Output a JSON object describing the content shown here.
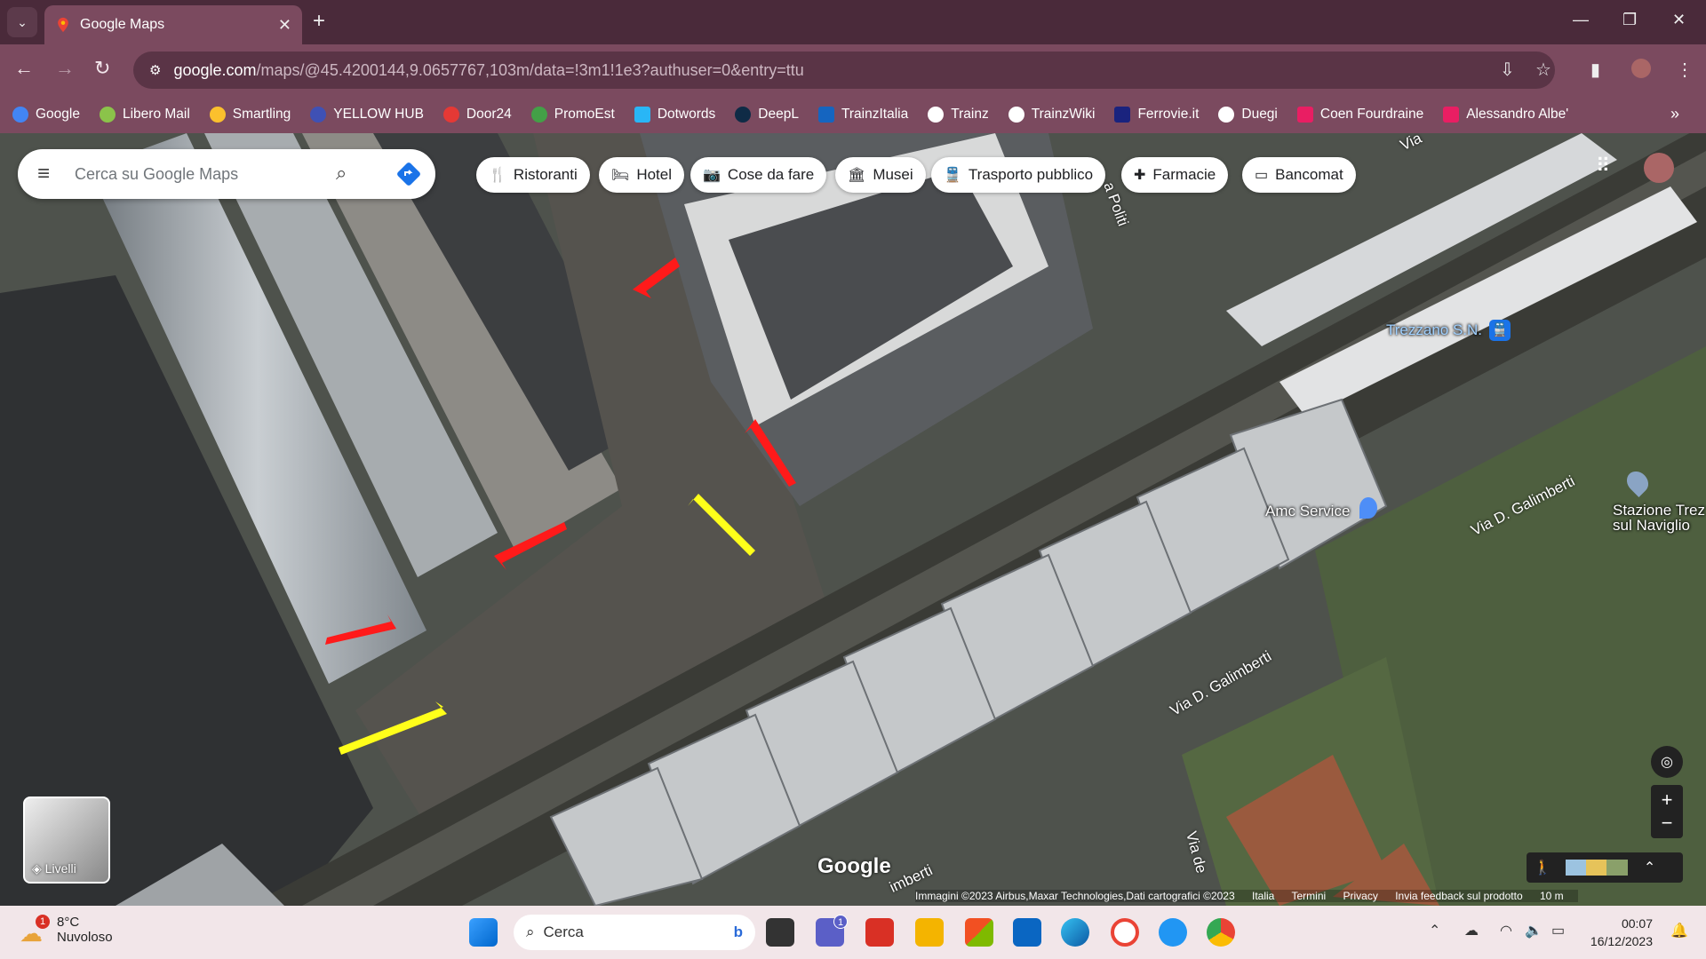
{
  "browser": {
    "tab_title": "Google Maps",
    "tab_close": "✕",
    "new_tab": "+",
    "url_host": "google.com",
    "url_path": "/maps/@45.4200144,9.0657767,103m/data=!3m1!1e3?authuser=0&entry=ttu"
  },
  "bookmarks": [
    {
      "label": "Google",
      "color": "#4285f4"
    },
    {
      "label": "Libero Mail",
      "color": "#8bc34a"
    },
    {
      "label": "Smartling",
      "color": "#fbc02d"
    },
    {
      "label": "YELLOW HUB",
      "color": "#3f51b5"
    },
    {
      "label": "Door24",
      "color": "#e53935"
    },
    {
      "label": "PromoEst",
      "color": "#43a047"
    },
    {
      "label": "Dotwords",
      "color": "#29b6f6"
    },
    {
      "label": "DeepL",
      "color": "#0f2b46"
    },
    {
      "label": "TrainzItalia",
      "color": "#1565c0"
    },
    {
      "label": "Trainz",
      "color": "#ffffff"
    },
    {
      "label": "TrainzWiki",
      "color": "#ffffff"
    },
    {
      "label": "Ferrovie.it",
      "color": "#1a237e"
    },
    {
      "label": "Duegi",
      "color": "#ffffff"
    },
    {
      "label": "Coen Fourdraine",
      "color": "#e91e63"
    },
    {
      "label": "Alessandro Albe'",
      "color": "#e91e63"
    }
  ],
  "maps": {
    "search_placeholder": "Cerca su Google Maps",
    "chips": [
      {
        "label": "Ristoranti",
        "icon": "fork-knife-icon"
      },
      {
        "label": "Hotel",
        "icon": "bed-icon"
      },
      {
        "label": "Cose da fare",
        "icon": "camera-icon"
      },
      {
        "label": "Musei",
        "icon": "museum-icon"
      },
      {
        "label": "Trasporto pubblico",
        "icon": "train-icon"
      },
      {
        "label": "Farmacie",
        "icon": "pharmacy-icon"
      },
      {
        "label": "Bancomat",
        "icon": "atm-icon"
      }
    ],
    "labels": {
      "station": "Trezzano S.N.",
      "amc": "Amc Service",
      "stazione_1": "Stazione Trez",
      "stazione_2": "sul Naviglio",
      "road_galimberti_1": "Via D. Galimberti",
      "road_galimberti_2": "Via D. Galimberti",
      "road_politi": "a Politi",
      "road_via_top": "Via",
      "road_via_de": "Via de",
      "road_imberti": "imberti",
      "google_logo": "Google"
    },
    "layers_label": "Livelli",
    "attribution": [
      "Immagini ©2023 Airbus,Maxar Technologies,Dati cartografici ©2023",
      "Italia",
      "Termini",
      "Privacy",
      "Invia feedback sul prodotto",
      "10 m"
    ]
  },
  "taskbar": {
    "weather_temp": "8°C",
    "weather_desc": "Nuvoloso",
    "weather_badge": "1",
    "search": "Cerca",
    "teams_badge": "1",
    "time": "00:07",
    "date": "16/12/2023"
  }
}
